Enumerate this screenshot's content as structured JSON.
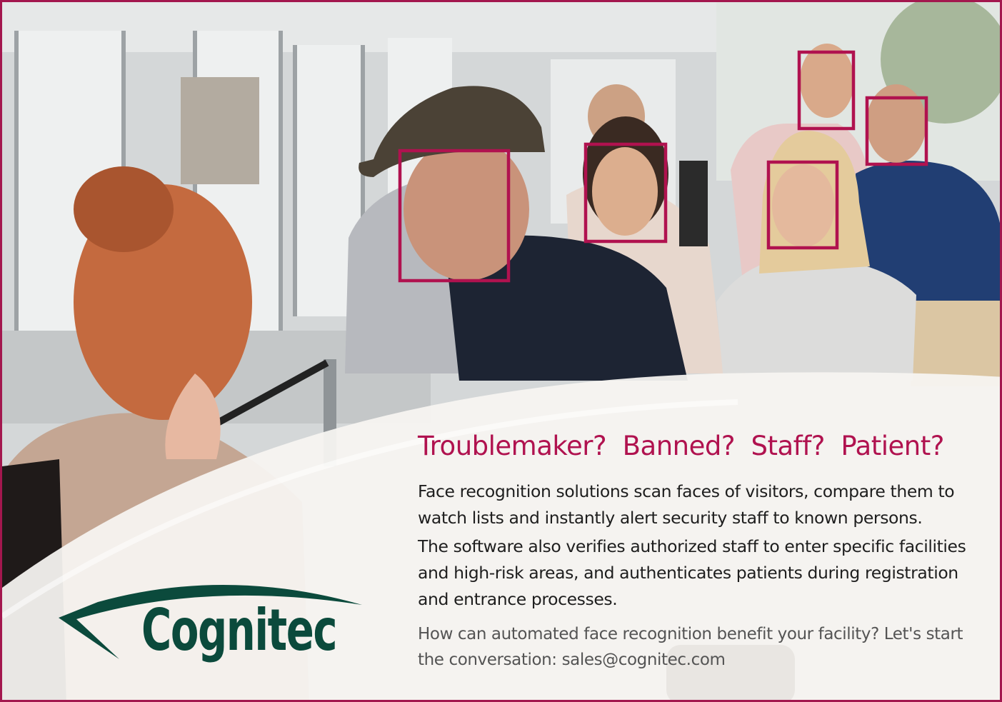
{
  "headline": "Troublemaker?  Banned?  Staff?  Patient?",
  "paragraphs": [
    "Face recognition solutions scan faces of visitors, compare them to watch lists and instantly alert security staff to known persons.",
    "The software also verifies authorized staff to enter specific facilities and high-risk areas, and authenticates patients during registration and entrance processes."
  ],
  "cta": "How can automated face recognition benefit your facility? Let's start the conversation: sales@cognitec.com",
  "brand": {
    "name": "Cognitec",
    "logo_color": "#0b4a3c",
    "accent_color": "#b0124f"
  },
  "face_detections": [
    {
      "person": "man-in-cap"
    },
    {
      "person": "dark-haired-woman"
    },
    {
      "person": "older-man"
    },
    {
      "person": "man-with-glasses"
    },
    {
      "person": "blonde-woman"
    }
  ]
}
